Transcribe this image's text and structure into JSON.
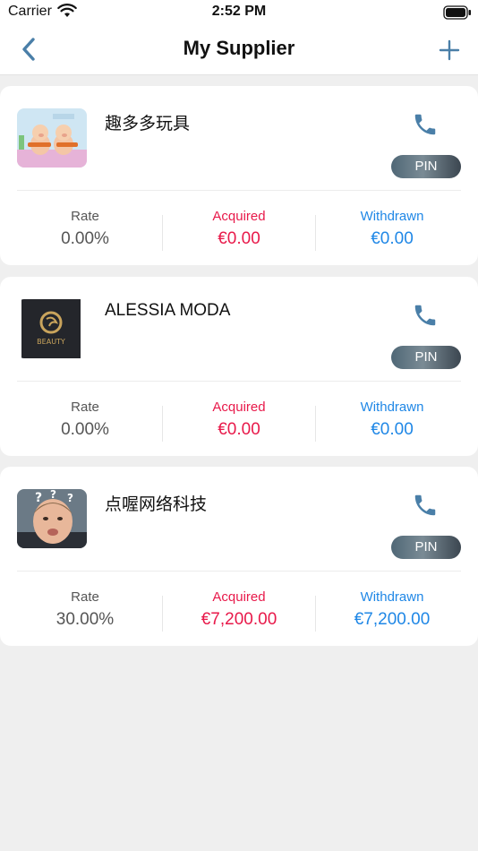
{
  "status_bar": {
    "carrier": "Carrier",
    "time": "2:52 PM"
  },
  "nav": {
    "title": "My Supplier",
    "back_icon": "chevron-left-icon",
    "add_icon": "plus-icon"
  },
  "colors": {
    "accent": "#1f87e6",
    "acquired": "#e8194a",
    "icon_blue": "#4a7fa8",
    "pin_dark": "#3b4650"
  },
  "suppliers": [
    {
      "name": "趣多多玩具",
      "pin_label": "PIN",
      "rate_label": "Rate",
      "rate_value": "0.00%",
      "acquired_label": "Acquired",
      "acquired_value": "€0.00",
      "withdrawn_label": "Withdrawn",
      "withdrawn_value": "€0.00"
    },
    {
      "name": "ALESSIA MODA",
      "pin_label": "PIN",
      "logo_text": "BEAUTY",
      "rate_label": "Rate",
      "rate_value": "0.00%",
      "acquired_label": "Acquired",
      "acquired_value": "€0.00",
      "withdrawn_label": "Withdrawn",
      "withdrawn_value": "€0.00"
    },
    {
      "name": "点喔网络科技",
      "pin_label": "PIN",
      "rate_label": "Rate",
      "rate_value": "30.00%",
      "acquired_label": "Acquired",
      "acquired_value": "€7,200.00",
      "withdrawn_label": "Withdrawn",
      "withdrawn_value": "€7,200.00"
    }
  ]
}
